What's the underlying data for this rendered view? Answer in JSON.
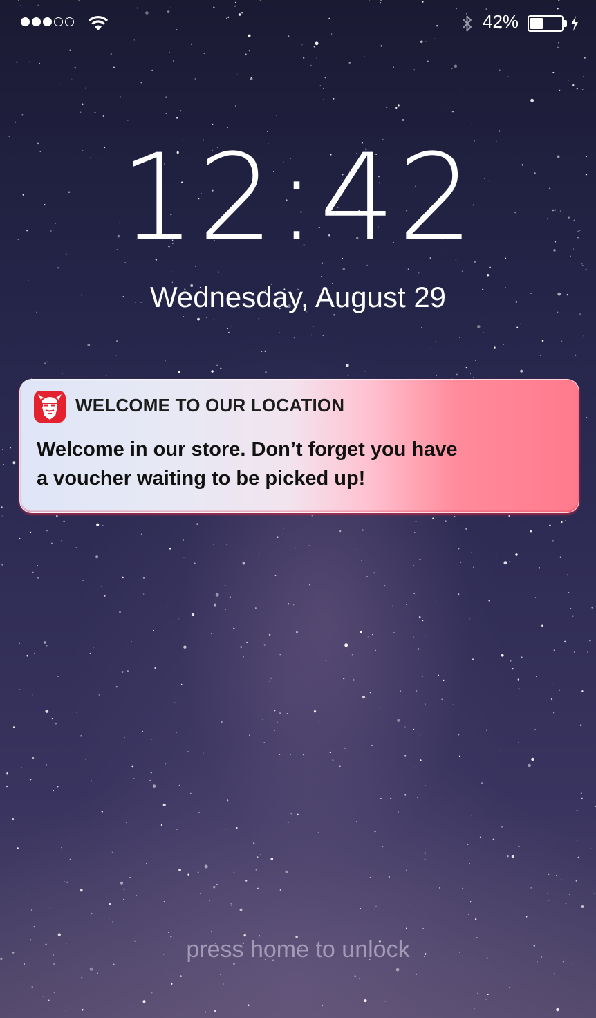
{
  "status_bar": {
    "signal_strength": 3,
    "signal_max": 5,
    "wifi_icon": "wifi-icon",
    "bluetooth_icon": "bluetooth-icon",
    "battery_percent_label": "42%",
    "battery_level": 0.42,
    "charging_icon": "lightning-icon"
  },
  "lock_screen": {
    "time": "12:42",
    "date": "Wednesday, August 29",
    "unlock_hint": "press home to unlock"
  },
  "notification": {
    "app_icon": "viking-head-icon",
    "title": "WELCOME TO OUR LOCATION",
    "body_line1": "Welcome in our store. Don’t forget you have",
    "body_line2": "a voucher waiting to be picked up!",
    "gradient_start": "#dfe6f7",
    "gradient_end": "#ff7a8c",
    "icon_color": "#e4212f"
  }
}
